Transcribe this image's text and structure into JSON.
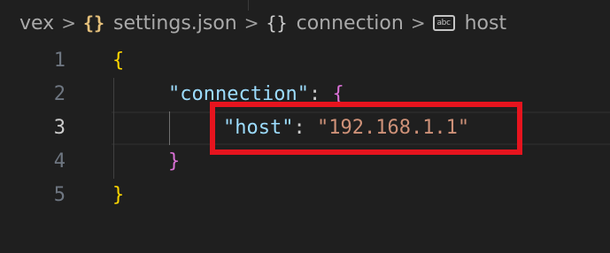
{
  "breadcrumb": {
    "items": [
      {
        "label": "vex",
        "icon": null
      },
      {
        "label": "settings.json",
        "icon": "json-braces-icon"
      },
      {
        "label": "connection",
        "icon": "object-braces-icon"
      },
      {
        "label": "host",
        "icon": "string-abc-icon"
      }
    ],
    "separator": ">",
    "braces_glyph": "{}",
    "abc_glyph": "abc"
  },
  "editor": {
    "lines": [
      {
        "number": "1"
      },
      {
        "number": "2"
      },
      {
        "number": "3"
      },
      {
        "number": "4"
      },
      {
        "number": "5"
      }
    ],
    "active_line": 3,
    "tokens": {
      "open_root": "{",
      "connection_key": "\"connection\"",
      "colon": ":",
      "open_obj": "{",
      "host_key": "\"host\"",
      "host_value": "\"192.168.1.1\"",
      "close_obj": "}",
      "close_root": "}"
    }
  },
  "colors": {
    "background": "#1f1f1f",
    "json_key": "#9cdcfe",
    "json_string": "#ce9178",
    "bracket_level_1": "#ffd700",
    "bracket_level_2": "#da70d6",
    "highlight_box": "#e6141e",
    "json_icon": "#e5c07b"
  }
}
